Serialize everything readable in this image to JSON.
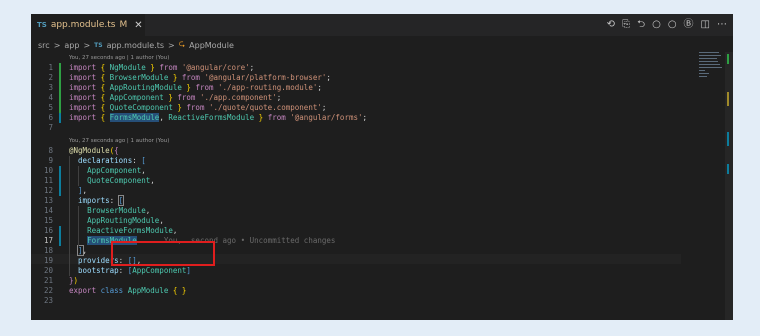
{
  "tab": {
    "type_tag": "TS",
    "file_name": "app.module.ts",
    "modified": "M",
    "close": "✕"
  },
  "toolbar_icons": [
    "history-icon",
    "compare-icon",
    "go-back-icon",
    "prev-change-icon",
    "next-change-icon",
    "copilot-icon",
    "split-editor-icon",
    "more-actions-icon"
  ],
  "breadcrumb": {
    "folder1": "src",
    "folder2": "app",
    "type_tag": "TS",
    "file": "app.module.ts",
    "symbol": "AppModule",
    "sep": ">"
  },
  "codelens": {
    "top": "You, 27 seconds ago | 1 author (You)",
    "decorator": "You, 27 seconds ago | 1 author (You)"
  },
  "lines": {
    "l1": [
      "1",
      "import",
      " { ",
      "NgModule",
      " } ",
      "from",
      " '@angular/core'",
      ";"
    ],
    "l2": [
      "2",
      "import",
      " { ",
      "BrowserModule",
      " } ",
      "from",
      " '@angular/platform-browser'",
      ";"
    ],
    "l3": [
      "3",
      "import",
      " { ",
      "AppRoutingModule",
      " } ",
      "from",
      " './app-routing.module'",
      ";"
    ],
    "l4": [
      "4",
      "import",
      " { ",
      "AppComponent",
      " } ",
      "from",
      " './app.component'",
      ";"
    ],
    "l5": [
      "5",
      "import",
      " { ",
      "QuoteComponent",
      " } ",
      "from",
      " './quote/quote.component'",
      ";"
    ],
    "l6": [
      "6",
      "import",
      " { ",
      "FormsModule",
      ", ",
      "ReactiveFormsModule",
      " } ",
      "from",
      " '@angular/forms'",
      ";"
    ],
    "l7": [
      "7"
    ],
    "l8": [
      "8",
      "@",
      "NgModule",
      "(",
      "{"
    ],
    "l9": [
      "9",
      "declarations",
      ": ",
      "["
    ],
    "l10": [
      "10",
      "AppComponent",
      ","
    ],
    "l11": [
      "11",
      "QuoteComponent",
      ","
    ],
    "l12": [
      "12",
      "]",
      ","
    ],
    "l13": [
      "13",
      "imports",
      ": ",
      "["
    ],
    "l14": [
      "14",
      "BrowserModule",
      ","
    ],
    "l15": [
      "15",
      "AppRoutingModule",
      ","
    ],
    "l16": [
      "16",
      "ReactiveFormsModule",
      ","
    ],
    "l17": [
      "17",
      "FormsModule",
      "You,  second ago • Uncommitted changes"
    ],
    "l18": [
      "18",
      "]",
      ","
    ],
    "l19": [
      "19",
      "providers",
      ": ",
      "[]",
      ","
    ],
    "l20": [
      "20",
      "bootstrap",
      ": ",
      "[",
      "AppComponent",
      "]"
    ],
    "l21": [
      "21",
      "}",
      ")"
    ],
    "l22": [
      "22",
      "export",
      " ",
      "class",
      " ",
      "AppModule",
      " { }"
    ],
    "l23": [
      "23"
    ]
  },
  "colors": {
    "editor_bg": "#1e1e1e",
    "highlight_box": "#e01e1e",
    "added_gutter": "#2ea043",
    "modified_gutter": "#0c7d9d"
  }
}
